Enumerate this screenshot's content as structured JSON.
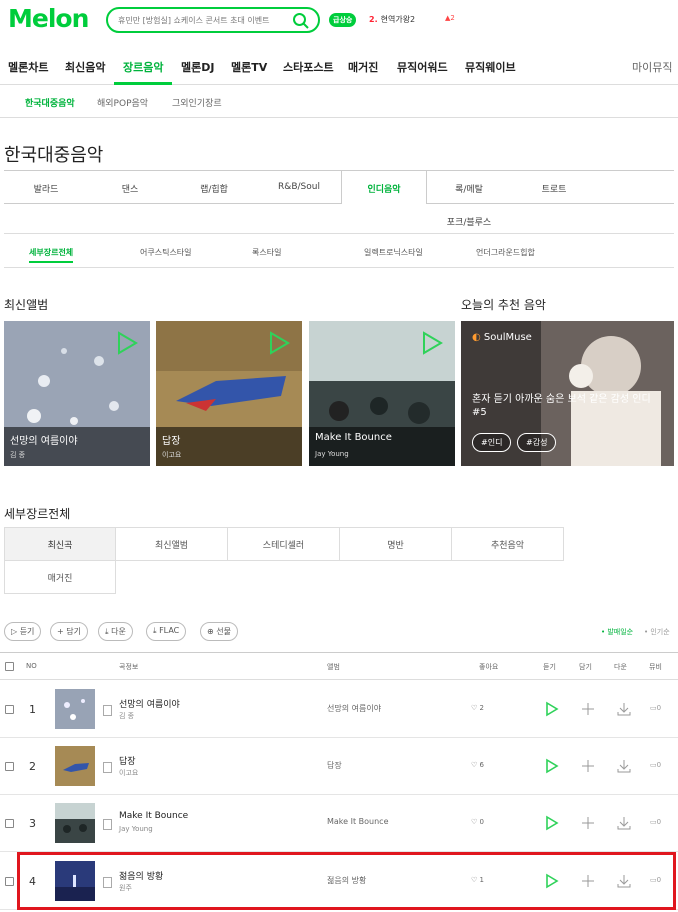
{
  "header": {
    "logo": "Melon",
    "search_placeholder": "휴민만 [방험실] 쇼케이스 콘서트 초대 이벤트",
    "rank_badge": "급상승",
    "rank_no": "2.",
    "rank_text": "현역가왕2",
    "rank_change": "▲2"
  },
  "gnb": {
    "items": [
      "멜론차트",
      "최신음악",
      "장르음악",
      "멜론DJ",
      "멜론TV",
      "스타포스트",
      "매거진",
      "뮤직어워드",
      "뮤직웨이브"
    ],
    "my_music": "마이뮤직"
  },
  "sub_nav": [
    "한국대중음악",
    "해외POP음악",
    "그외인기장르"
  ],
  "page_title": "한국대중음악",
  "genre_tabs": [
    "발라드",
    "댄스",
    "랩/힙합",
    "R&B/Soul",
    "인디음악",
    "록/메탈",
    "트로트",
    "포크/블루스"
  ],
  "detail_tabs": [
    "세부장르전체",
    "어쿠스틱스타일",
    "록스타일",
    "일렉트로닉스타일",
    "언더그라운드힙합"
  ],
  "sections": {
    "new_albums": "최신앨범",
    "today_reco": "오늘의 추천 음악",
    "detail_all": "세부장르전체"
  },
  "albums": [
    {
      "title": "선망의 여름이야",
      "artist": "김 종"
    },
    {
      "title": "답장",
      "artist": "이고요"
    },
    {
      "title": "Make It Bounce",
      "artist": "Jay Young"
    }
  ],
  "reco": {
    "brand_mark": "◐",
    "brand": "SoulMuse",
    "desc": "혼자 듣기 아까운 숨은 보석 같은 감성 인디 #5",
    "tags": [
      "#인디",
      "#감성"
    ]
  },
  "list_tabs": [
    "최신곡",
    "최신앨범",
    "스테디셀러",
    "명반",
    "추천음악",
    "매거진"
  ],
  "toolbar": {
    "buttons": [
      "▷ 듣기",
      "+ 담기",
      "⤓ 다운",
      "⤓ FLAC",
      "⊕ 선물"
    ],
    "sort_new": "• 발매일순",
    "sort_pop": "• 인기순"
  },
  "table_head": {
    "no": "NO",
    "song": "곡정보",
    "album": "앨범",
    "like": "좋아요",
    "listen": "듣기",
    "add": "담기",
    "down": "다운",
    "mv": "뮤비"
  },
  "songs": [
    {
      "no": "1",
      "title": "선망의 여름이야",
      "artist": "김 종",
      "album": "선망의 여름이야",
      "likes": "♡ 2",
      "mv": "0"
    },
    {
      "no": "2",
      "title": "답장",
      "artist": "이고요",
      "album": "답장",
      "likes": "♡ 6",
      "mv": "0"
    },
    {
      "no": "3",
      "title": "Make It Bounce",
      "artist": "Jay Young",
      "album": "Make It Bounce",
      "likes": "♡ 0",
      "mv": "0"
    },
    {
      "no": "4",
      "title": "젊음의 방황",
      "artist": "원주",
      "album": "젊음의 방황",
      "likes": "♡ 1",
      "mv": "0"
    }
  ],
  "colors": {
    "brand": "#00cd3c",
    "highlight": "#e0161e"
  }
}
